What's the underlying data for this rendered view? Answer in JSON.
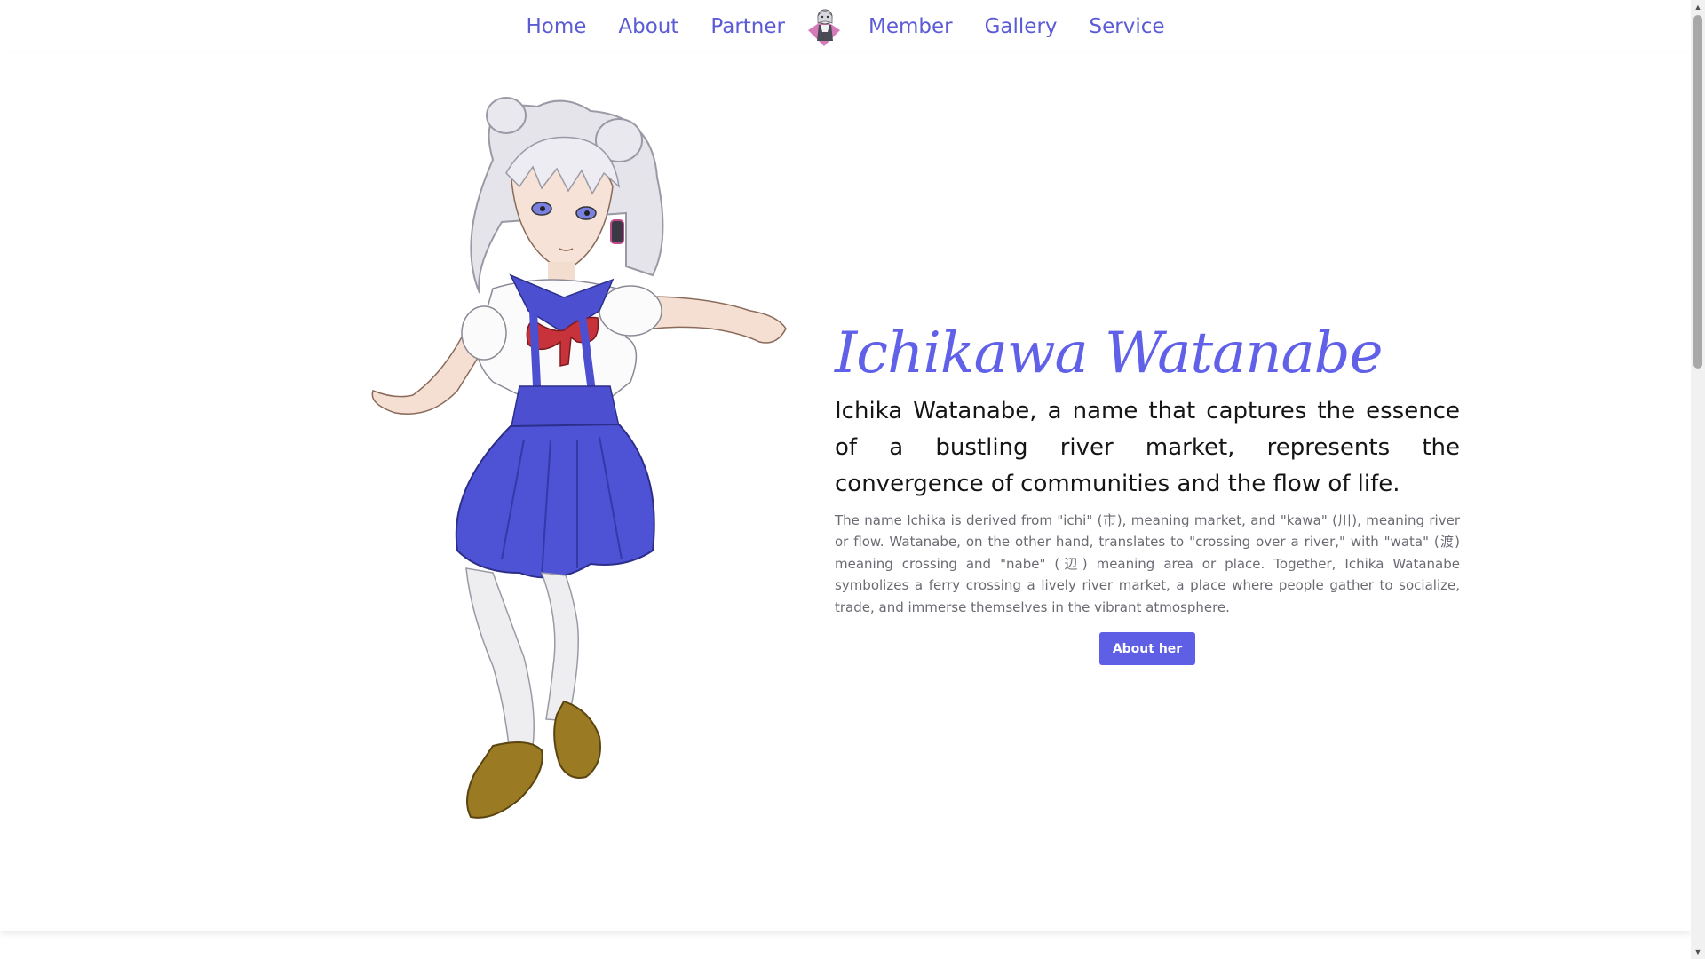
{
  "nav": {
    "items": [
      {
        "label": "Home"
      },
      {
        "label": "About"
      },
      {
        "label": "Partner"
      },
      {
        "label": "Member"
      },
      {
        "label": "Gallery"
      },
      {
        "label": "Service"
      }
    ],
    "logo_icon": "character-avatar-logo"
  },
  "hero": {
    "title": "Ichikawa Watanabe",
    "lead": "Ichika Watanabe, a name that captures the essence of a bustling river market, represents the convergence of communities and the flow of life.",
    "body": "The name Ichika is derived from \"ichi\" (市), meaning market, and \"kawa\" (川), meaning river or flow. Watanabe, on the other hand, translates to \"crossing over a river,\" with \"wata\" (渡) meaning crossing and \"nabe\" (辺) meaning area or place. Together, Ichika Watanabe symbolizes a ferry crossing a lively river market, a place where people gather to socialize, trade, and immerse themselves in the vibrant atmosphere.",
    "button_label": "About her",
    "image_icon": "anime-girl-illustration"
  },
  "colors": {
    "accent": "#5f5fe6",
    "nav_link": "#5b5bd6",
    "uniform_blue": "#4b4fd0",
    "bow_red": "#c8323a",
    "shoe_brown": "#9a7a22"
  }
}
